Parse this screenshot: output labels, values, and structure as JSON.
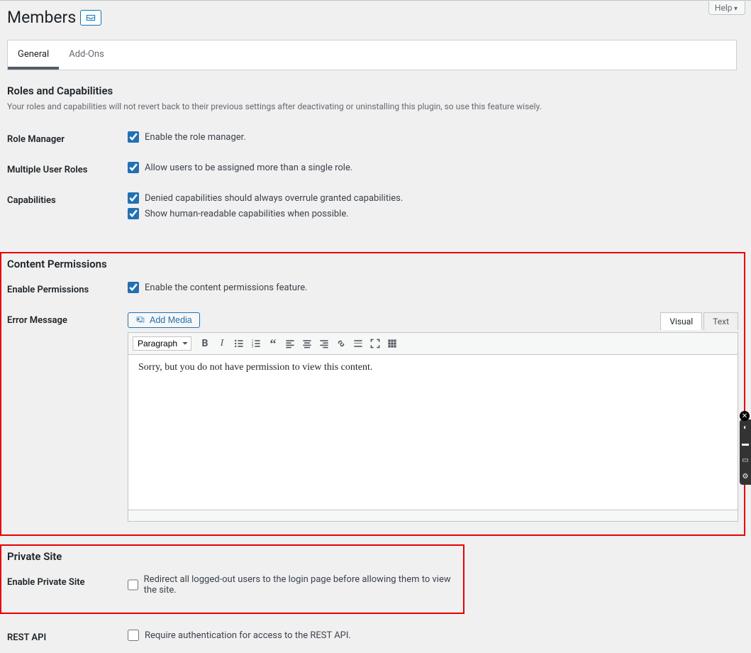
{
  "help_label": "Help",
  "page_title": "Members",
  "tabs": [
    {
      "label": "General",
      "active": true
    },
    {
      "label": "Add-Ons",
      "active": false
    }
  ],
  "sections": {
    "roles": {
      "title": "Roles and Capabilities",
      "desc": "Your roles and capabilities will not revert back to their previous settings after deactivating or uninstalling this plugin, so use this feature wisely.",
      "rows": {
        "role_manager": {
          "th": "Role Manager",
          "label": "Enable the role manager.",
          "checked": true
        },
        "multi_roles": {
          "th": "Multiple User Roles",
          "label": "Allow users to be assigned more than a single role.",
          "checked": true
        },
        "caps": {
          "th": "Capabilities",
          "label1": "Denied capabilities should always overrule granted capabilities.",
          "label2": "Show human-readable capabilities when possible.",
          "checked1": true,
          "checked2": true
        }
      }
    },
    "content": {
      "title": "Content Permissions",
      "rows": {
        "enable": {
          "th": "Enable Permissions",
          "label": "Enable the content permissions feature.",
          "checked": true
        },
        "error": {
          "th": "Error Message",
          "add_media": "Add Media",
          "visual_tab": "Visual",
          "text_tab": "Text",
          "format": "Paragraph",
          "content": "Sorry, but you do not have permission to view this content."
        }
      }
    },
    "private": {
      "title": "Private Site",
      "rows": {
        "enable": {
          "th": "Enable Private Site",
          "label": "Redirect all logged-out users to the login page before allowing them to view the site.",
          "checked": false
        },
        "rest": {
          "th": "REST API",
          "label": "Require authentication for access to the REST API.",
          "checked": false
        }
      }
    }
  }
}
